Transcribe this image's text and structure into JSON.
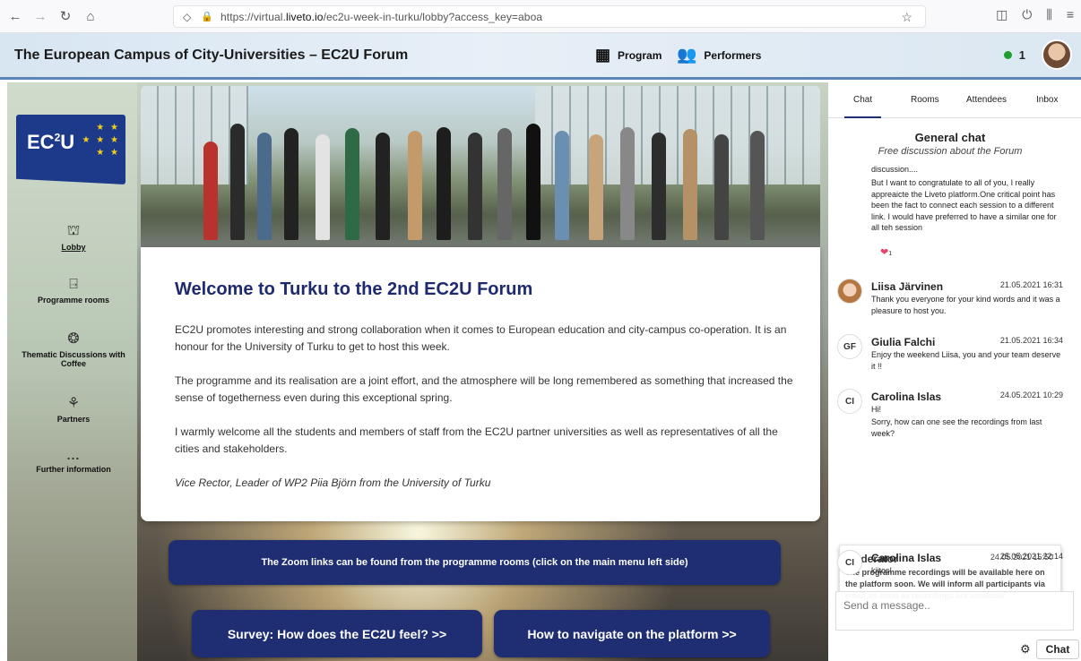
{
  "browser": {
    "url_prefix": "https://virtual.",
    "url_domain": "liveto.io",
    "url_path": "/ec2u-week-in-turku/lobby?access_key=aboa"
  },
  "header": {
    "title": "The European Campus of City-Universities – EC2U Forum",
    "nav": [
      {
        "label": "Program",
        "icon": "calendar-icon"
      },
      {
        "label": "Performers",
        "icon": "people-icon"
      }
    ],
    "online_count": "1"
  },
  "logo": {
    "text": "EC",
    "sup": "2",
    "text2": "U"
  },
  "sidebar": {
    "items": [
      {
        "label": "Lobby",
        "icon": "lobby-icon",
        "active": true
      },
      {
        "label": "Programme rooms",
        "icon": "door-icon"
      },
      {
        "label": "Thematic Discussions with Coffee",
        "icon": "discussion-icon"
      },
      {
        "label": "Partners",
        "icon": "handshake-icon"
      },
      {
        "label": "Further information",
        "icon": "more-icon"
      }
    ],
    "more_glyph": "..."
  },
  "welcome": {
    "heading": "Welcome to Turku to the 2nd EC2U Forum",
    "p1": "EC2U promotes interesting and strong collaboration when it comes to European education and city-campus co-operation. It is an honour for the University of Turku to get to host this week.",
    "p2": "The programme and its realisation are a joint effort, and the atmosphere will be long remembered as something that increased the sense of togetherness even during this exceptional spring.",
    "p3": "I warmly welcome all the students and members of staff from the EC2U partner universities as well as representatives of all the cities and stakeholders.",
    "signature": "Vice Rector, Leader of WP2 Piia Björn from the University of Turku"
  },
  "banners": {
    "zoom": "The Zoom links can be found from the programme rooms (click on the main menu left side)",
    "survey": "Survey: How does the EC2U feel? >>",
    "navigate": "How to navigate on the platform >>"
  },
  "chat": {
    "tabs": [
      "Chat",
      "Rooms",
      "Attendees",
      "Inbox"
    ],
    "active_tab": "Chat",
    "general_title": "General chat",
    "general_sub": "Free discussion about the Forum",
    "prior_text_1": "discussion....",
    "prior_text_2": "But I want to congratulate to all of you, I really appreaicte the Liveto platform.One critical point has been the fact to connect each session to a different link. I would have preferred to have a similar one for all teh session",
    "reaction_count": "1",
    "messages": [
      {
        "initials": "",
        "name": "Liisa Järvinen",
        "time": "21.05.2021 16:31",
        "body": "Thank you everyone for your kind words and it was a pleasure to host you."
      },
      {
        "initials": "GF",
        "name": "Giulia Falchi",
        "time": "21.05.2021 16:34",
        "body": "Enjoy the weekend Liisa, you and your team deserve it !!"
      },
      {
        "initials": "CI",
        "name": "Carolina Islas",
        "time": "24.05.2021 10:29",
        "body": "Hi!",
        "body2": "Sorry, how can one see the recordings from last week?"
      },
      {
        "initials": "CI",
        "name": "Carolina Islas",
        "time": "25.05.2021 22:14",
        "body": "kiitos!"
      }
    ],
    "moderator": {
      "name": "Moderator",
      "time": "24.05.2021 15:50",
      "body": "The programme recordings will be available here on the platform soon. We will inform all participants via email as soon as recordings are available."
    },
    "input_placeholder": "Send a message..",
    "chat_button": "Chat"
  },
  "colors": {
    "accent": "#1f2e72",
    "online": "#1e9e2e",
    "heart": "#e5446b"
  }
}
